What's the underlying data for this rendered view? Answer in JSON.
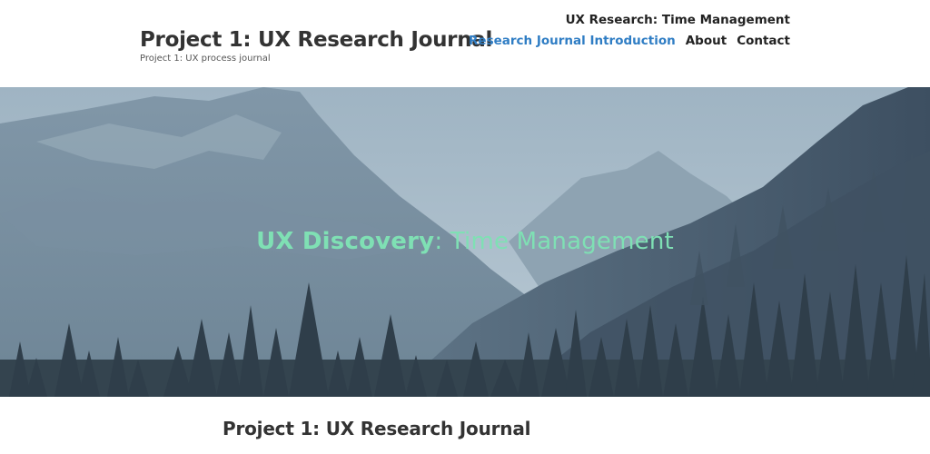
{
  "site": {
    "title": "Project 1: UX Research Journal",
    "tagline": "Project 1: UX process journal"
  },
  "nav": {
    "top_item": "UX Research: Time Management",
    "items": [
      {
        "label": "Research Journal Introduction",
        "active": true
      },
      {
        "label": "About",
        "active": false
      },
      {
        "label": "Contact",
        "active": false
      }
    ]
  },
  "hero": {
    "heading_strong": "UX Discovery",
    "heading_rest": ": Time Management",
    "text_color": "#7fe0b4"
  },
  "content": {
    "heading": "Project 1: UX Research Journal"
  },
  "colors": {
    "accent": "#2f7dc4",
    "hero_sky": "#a9bccb",
    "forest": "#3a4a5a"
  }
}
